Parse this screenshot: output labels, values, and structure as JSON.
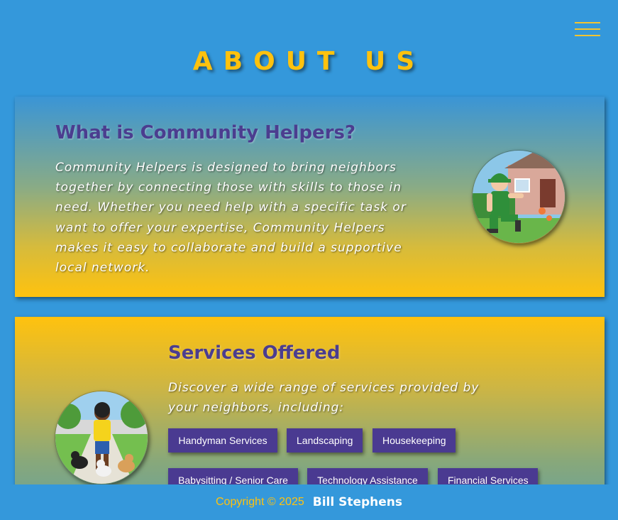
{
  "header": {
    "menu_icon": "hamburger-menu-icon",
    "title": "ABOUT US"
  },
  "about": {
    "heading": "What is Community Helpers?",
    "body": "Community Helpers is designed to bring neighbors together by connecting those with skills to those in need. Whether you need help with a specific task or want to offer your expertise, Community Helpers makes it easy to collaborate and build a supportive local network.",
    "image": "gardener-illustration"
  },
  "services": {
    "heading": "Services Offered",
    "intro": "Discover a wide range of services provided by your neighbors, including:",
    "image": "dog-walker-illustration",
    "items": [
      {
        "label": "Handyman Services"
      },
      {
        "label": "Landscaping"
      },
      {
        "label": "Housekeeping"
      },
      {
        "label": "Babysitting / Senior Care"
      },
      {
        "label": "Technology Assistance"
      },
      {
        "label": "Financial Services"
      }
    ]
  },
  "footer": {
    "copyright": "Copyright © 2025",
    "author": "Bill Stephens"
  },
  "colors": {
    "background": "#3498db",
    "accent_gold": "#ffc20e",
    "heading_purple": "#4b3d8f",
    "button_purple": "#4a3a91"
  }
}
